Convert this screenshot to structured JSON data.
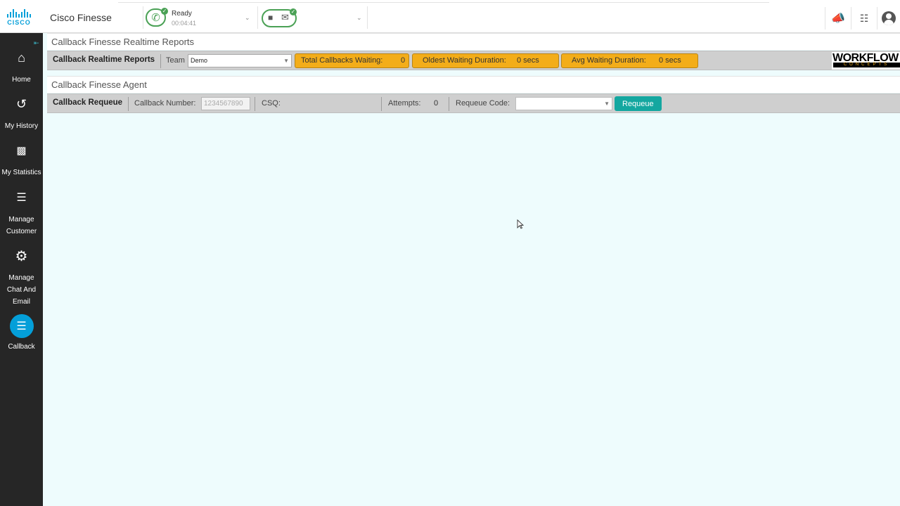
{
  "header": {
    "app_title": "Cisco Finesse",
    "logo_text": "CISCO",
    "voice_state": "Ready",
    "voice_timer": "00:04:41",
    "icons": [
      "phone-icon",
      "chat-icon",
      "mail-icon",
      "broadcast-icon",
      "dialpad-icon",
      "user-avatar-icon"
    ]
  },
  "sidebar": {
    "items": [
      {
        "label": "Home",
        "icon": "home-icon"
      },
      {
        "label": "My History",
        "icon": "history-icon"
      },
      {
        "label": "My Statistics",
        "icon": "statistics-icon"
      },
      {
        "label": "Manage",
        "label2": "Customer",
        "icon": "manage-customer-icon"
      },
      {
        "label": "Manage",
        "label2": "Chat And",
        "label3": "Email",
        "icon": "gear-icon"
      },
      {
        "label": "Callback",
        "icon": "callback-icon",
        "active": true
      }
    ]
  },
  "reports_panel": {
    "title": "Callback Finesse Realtime Reports",
    "toolbar_title": "Callback Realtime Reports",
    "team_label": "Team",
    "team_value": "Demo",
    "total_waiting_label": "Total Callbacks Waiting:",
    "total_waiting_value": "0",
    "oldest_label": "Oldest Waiting Duration:",
    "oldest_value": "0 secs",
    "avg_label": "Avg Waiting Duration:",
    "avg_value": "0 secs",
    "logo_top": "WORKFLOW",
    "logo_bottom": "CONCEPTS"
  },
  "agent_panel": {
    "title": "Callback Finesse Agent",
    "toolbar_title": "Callback Requeue",
    "callback_number_label": "Callback Number:",
    "callback_number_placeholder": "1234567890",
    "csq_label": "CSQ:",
    "attempts_label": "Attempts:",
    "attempts_value": "0",
    "requeue_code_label": "Requeue Code:",
    "requeue_code_value": "",
    "requeue_button": "Requeue"
  },
  "colors": {
    "sidebar_bg": "#262626",
    "accent_blue": "#049fd9",
    "stat_orange": "#f3ad19",
    "requeue_teal": "#14a7a0",
    "ready_green": "#4aa155",
    "content_bg": "#eefcfd"
  }
}
